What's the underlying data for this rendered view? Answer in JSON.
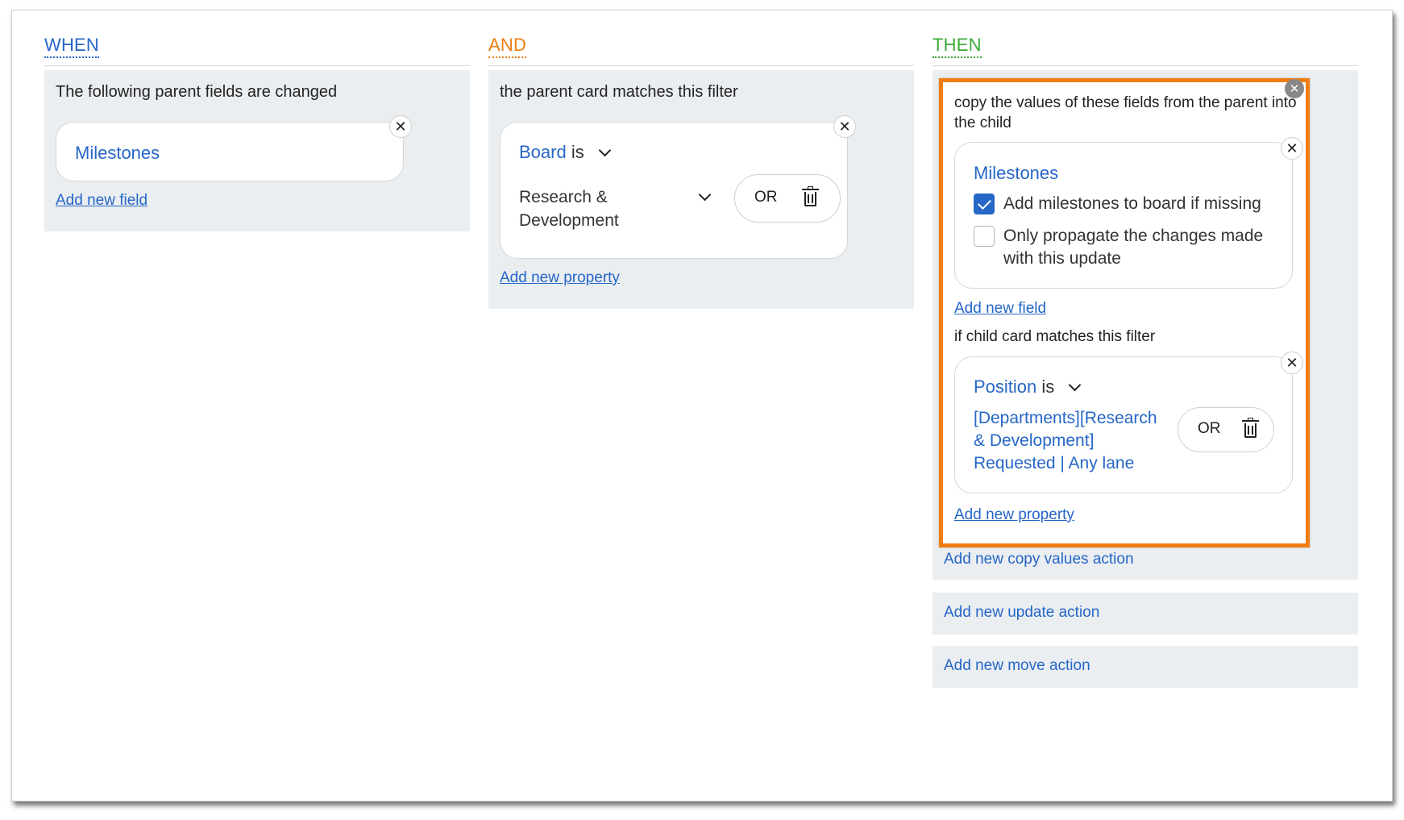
{
  "when": {
    "title": "WHEN",
    "color": "#2566c7",
    "panel_title": "The following parent fields are changed",
    "field": "Milestones",
    "add_link": "Add new field"
  },
  "and": {
    "title": "AND",
    "color": "#ef7d10",
    "panel_title": "the parent card matches this filter",
    "property": "Board",
    "operator": "is",
    "value_line1": "Research &",
    "value_line2": "Development",
    "or_label": "OR",
    "add_link": "Add new property"
  },
  "then": {
    "title": "THEN",
    "color": "#3aa935",
    "copy_title_line1": "copy the values of these fields from the parent into",
    "copy_title_line2": "the child",
    "field": "Milestones",
    "checkbox_add_milestones": {
      "label": "Add milestones to board if missing",
      "checked": true
    },
    "checkbox_propagate": {
      "label_line1": "Only propagate the changes made",
      "label_line2": "with this update",
      "checked": false
    },
    "add_field_link": "Add new field",
    "child_filter_title": "if child card matches this filter",
    "property": "Position",
    "operator": "is",
    "value_line1": "[Departments][Research",
    "value_line2": "& Development]",
    "value_line3": "Requested | Any lane",
    "or_label": "OR",
    "add_property_link": "Add new property",
    "actions": [
      "Add new copy values action",
      "Add new update action",
      "Add new move action"
    ]
  },
  "icons": {
    "close": "close-icon",
    "chevron": "chevron-down-icon",
    "trash": "trash-icon",
    "check": "checkmark-icon"
  },
  "accent": "#ef7d10"
}
